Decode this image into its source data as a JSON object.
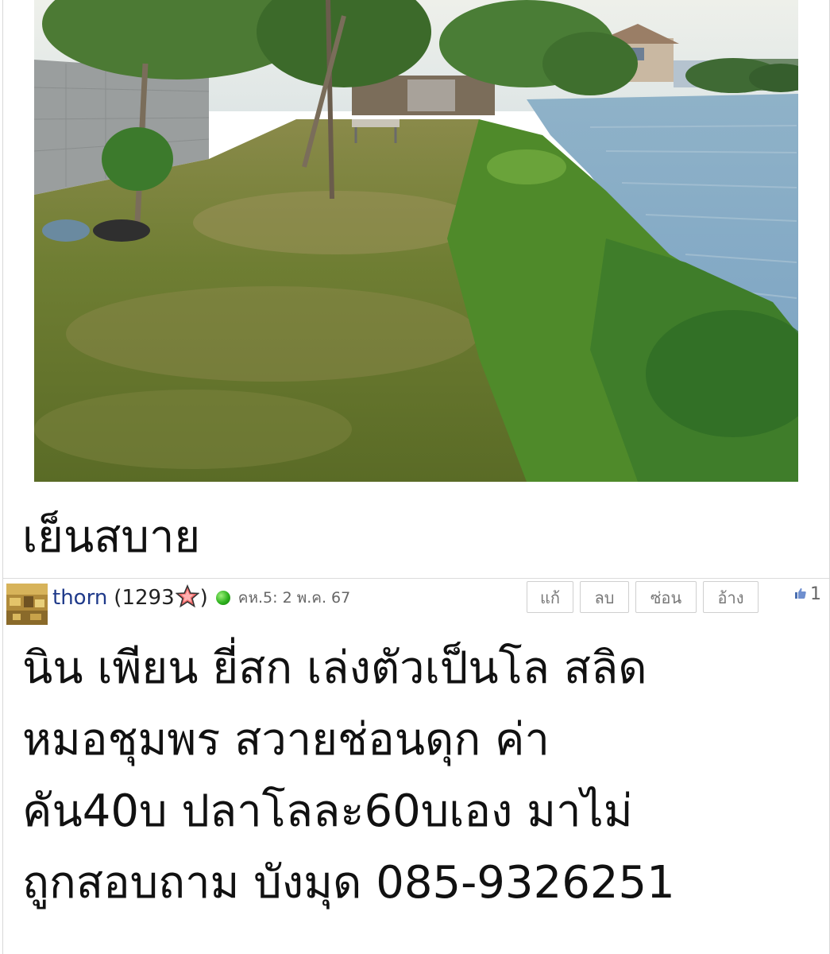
{
  "post": {
    "image_alt": "canal-side grass path photo",
    "caption": "เย็นสบาย"
  },
  "reply": {
    "username": "thorn",
    "rep_open": "(1293",
    "rep_close": ")",
    "date": "คห.5: 2 พ.ค. 67",
    "actions": {
      "edit": "แก้",
      "delete": "ลบ",
      "hide": "ซ่อน",
      "quote": "อ้าง"
    },
    "like_count": "1",
    "body_lines": [
      "นิน เพียน ยี่สก เล่งตัวเป็นโล สลิด",
      "หมอชุมพร  สวายช่อนดุก ค่า",
      "คัน40บ ปลาโลละ60บเอง มาไม่",
      "ถูกสอบถาม บังมุด 085-9326251"
    ]
  },
  "icons": {
    "star": "star-icon",
    "online": "online-status-icon",
    "like": "thumbs-up-icon"
  },
  "colors": {
    "username": "#1f3a8a",
    "online": "#2eb21e",
    "button_border": "#cfcfcf"
  }
}
